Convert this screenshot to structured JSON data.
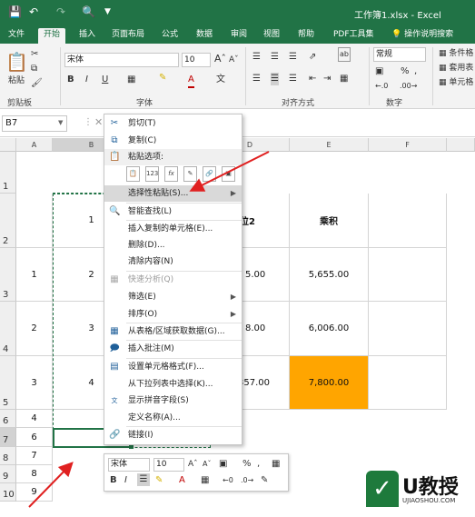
{
  "window": {
    "title": "工作簿1.xlsx - Excel"
  },
  "tabs": [
    "文件",
    "开始",
    "插入",
    "页面布局",
    "公式",
    "数据",
    "审阅",
    "视图",
    "帮助",
    "PDF工具集",
    "操作说明搜索"
  ],
  "ribbon": {
    "paste_label": "粘贴",
    "font_name": "宋体",
    "font_size": "10",
    "number_format": "常规",
    "conditional_format": "条件格",
    "table_format": "套用表",
    "cell_style": "单元格",
    "groups": [
      "剪贴板",
      "字体",
      "对齐方式",
      "数字"
    ]
  },
  "formula_bar": {
    "name_box": "B7"
  },
  "columns": [
    "A",
    "B",
    "C",
    "D",
    "E",
    "F"
  ],
  "rows": [
    "1",
    "2",
    "3",
    "4",
    "5",
    "6",
    "7",
    "8",
    "9",
    "10"
  ],
  "table": {
    "header_d": "单位2",
    "header_e": "乘积",
    "r3": {
      "a": "1",
      "b": "2",
      "d": "5.00",
      "e": "5,655.00"
    },
    "r4": {
      "a": "2",
      "b": "3",
      "d": "8.00",
      "e": "6,006.00"
    },
    "r5": {
      "a": "3",
      "b": "4",
      "d": "357.00",
      "e": "7,800.00"
    },
    "col_a_tail": [
      "4",
      "6",
      "7",
      "8",
      "9"
    ],
    "b2": "1"
  },
  "context_menu": {
    "items": [
      {
        "label": "剪切(T)",
        "icon": "scissors-icon"
      },
      {
        "label": "复制(C)",
        "icon": "copy-icon"
      },
      {
        "label": "粘贴选项:",
        "icon": "paste-icon"
      },
      {
        "label": "选择性粘贴(S)...",
        "icon": ""
      },
      {
        "label": "智能查找(L)",
        "icon": "search-icon"
      },
      {
        "label": "插入复制的单元格(E)...",
        "icon": ""
      },
      {
        "label": "删除(D)...",
        "icon": ""
      },
      {
        "label": "清除内容(N)",
        "icon": ""
      },
      {
        "label": "快速分析(Q)",
        "icon": "quick-analysis-icon"
      },
      {
        "label": "筛选(E)",
        "icon": ""
      },
      {
        "label": "排序(O)",
        "icon": ""
      },
      {
        "label": "从表格/区域获取数据(G)...",
        "icon": "table-icon"
      },
      {
        "label": "插入批注(M)",
        "icon": "comment-icon"
      },
      {
        "label": "设置单元格格式(F)...",
        "icon": "format-cells-icon"
      },
      {
        "label": "从下拉列表中选择(K)...",
        "icon": ""
      },
      {
        "label": "显示拼音字段(S)",
        "icon": "pinyin-icon"
      },
      {
        "label": "定义名称(A)...",
        "icon": ""
      },
      {
        "label": "链接(I)",
        "icon": "link-icon"
      }
    ],
    "paste_options": [
      "粘贴",
      "123",
      "fx",
      "格式",
      "链接",
      "图片"
    ]
  },
  "mini_toolbar": {
    "font_name": "宋体",
    "font_size": "10"
  },
  "logo": {
    "brand": "U教授",
    "url_text": "UJIAOSHOU.COM"
  },
  "colors": {
    "excel_green": "#217346",
    "highlight_fill": "#ffa500",
    "arrow_red": "#e02020"
  }
}
